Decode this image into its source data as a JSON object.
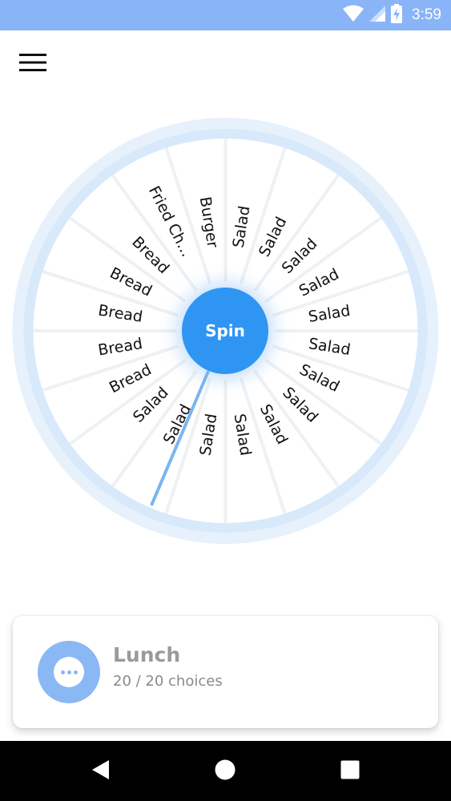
{
  "status_bar": {
    "time": "3:59",
    "background_color": "#8ab4f8",
    "icons": [
      "wifi-icon",
      "signal-icon",
      "battery-charging-icon"
    ]
  },
  "header": {
    "menu_icon": "hamburger-menu-icon"
  },
  "wheel": {
    "spin_label": "Spin",
    "accent_color": "#2f95f3",
    "pointer_color": "#7ab6f0",
    "segments": [
      "Salad",
      "Salad",
      "Salad",
      "Salad",
      "Salad",
      "Salad",
      "Salad",
      "Salad",
      "Salad",
      "Salad",
      "Salad",
      "Salad",
      "Salad",
      "Bread",
      "Bread",
      "Bread",
      "Bread",
      "Bread",
      "Fried Ch...",
      "Burger"
    ]
  },
  "card": {
    "title": "Lunch",
    "subtitle": "20 / 20 choices",
    "icon": "more-dots-icon",
    "avatar_color": "#8ab8f5"
  },
  "nav_bar": {
    "icons": [
      "back-icon",
      "home-icon",
      "recents-icon"
    ]
  }
}
